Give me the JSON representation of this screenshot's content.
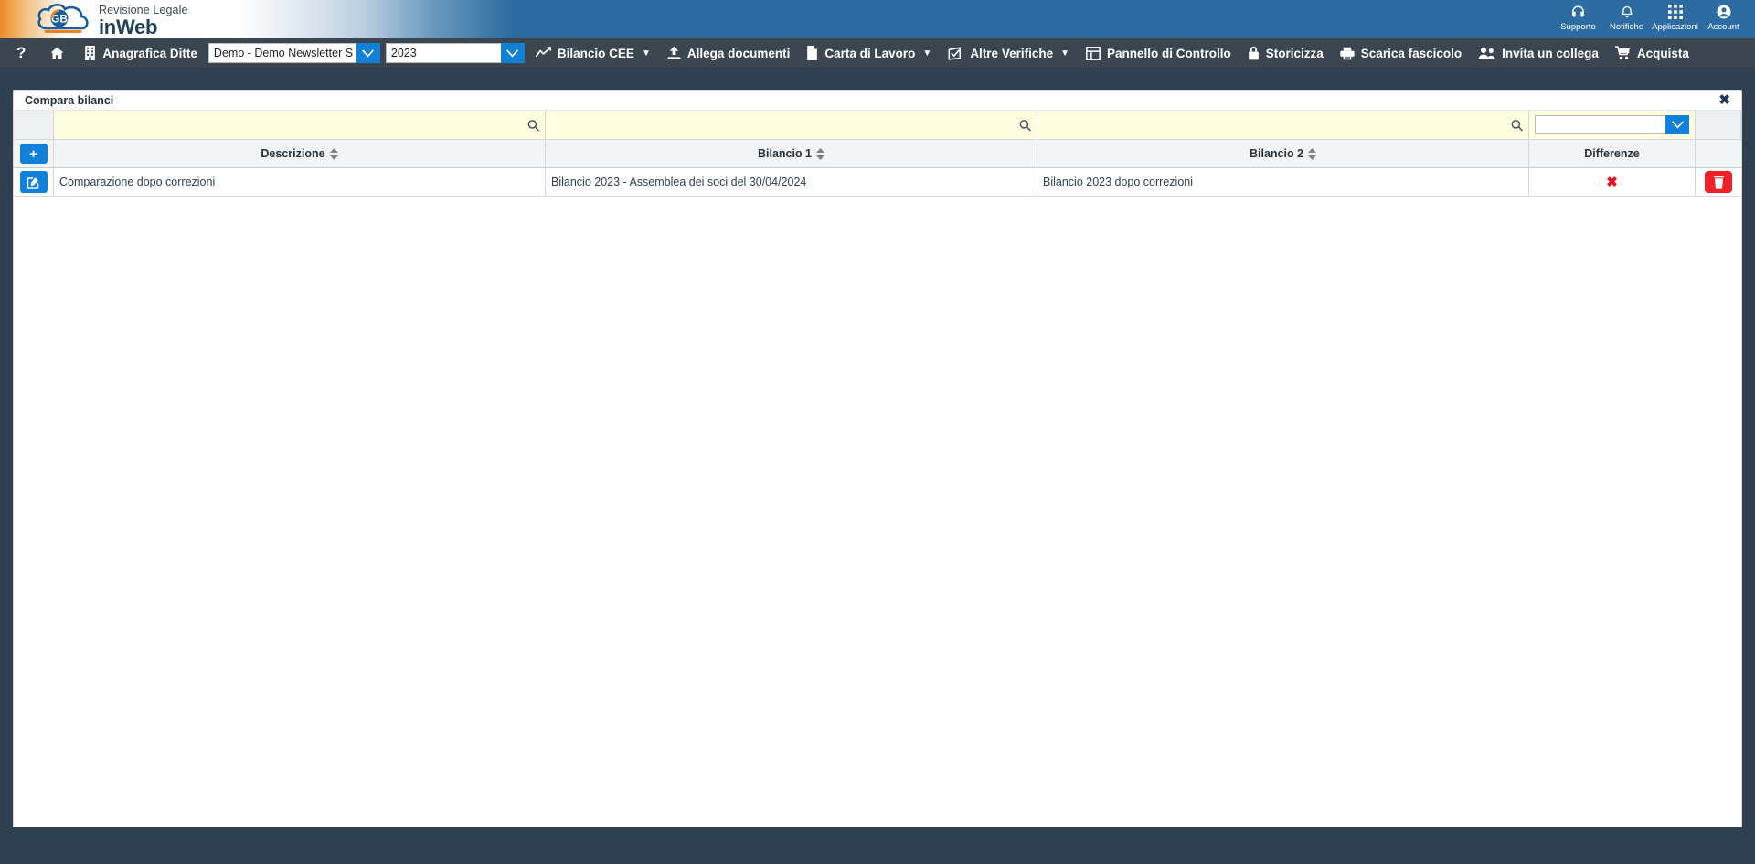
{
  "brand": {
    "line1": "Revisione Legale",
    "line2": "inWeb",
    "logo_text": "GB"
  },
  "header_tools": [
    {
      "label": "Supporto",
      "icon": "headset-icon"
    },
    {
      "label": "Notifiche",
      "icon": "bell-icon"
    },
    {
      "label": "Applicazioni",
      "icon": "grid-apps-icon"
    },
    {
      "label": "Account",
      "icon": "user-circle-icon"
    }
  ],
  "nav": {
    "help_label": "?",
    "home_icon": "home-icon",
    "items": [
      {
        "label": "Anagrafica Ditte",
        "icon": "building-icon",
        "caret": false
      },
      {
        "label": "Bilancio CEE",
        "icon": "chart-line-icon",
        "caret": true
      },
      {
        "label": "Allega documenti",
        "icon": "upload-icon",
        "caret": false
      },
      {
        "label": "Carta di Lavoro",
        "icon": "document-icon",
        "caret": true
      },
      {
        "label": "Altre Verifiche",
        "icon": "clipboard-check-icon",
        "caret": true
      },
      {
        "label": "Pannello di Controllo",
        "icon": "dashboard-grid-icon",
        "caret": false
      },
      {
        "label": "Storicizza",
        "icon": "lock-icon",
        "caret": false
      },
      {
        "label": "Scarica fascicolo",
        "icon": "printer-icon",
        "caret": false
      },
      {
        "label": "Invita un collega",
        "icon": "users-icon",
        "caret": false
      },
      {
        "label": "Acquista",
        "icon": "cart-icon",
        "caret": false
      }
    ],
    "firm_select": {
      "value": "Demo - Demo Newsletter S",
      "placeholder": ""
    },
    "year_select": {
      "value": "2023",
      "placeholder": ""
    }
  },
  "panel": {
    "title": "Compara bilanci",
    "close_label": "✖"
  },
  "grid": {
    "filters": {
      "descrizione": {
        "value": "",
        "placeholder": ""
      },
      "bilancio1": {
        "value": "",
        "placeholder": ""
      },
      "bilancio2": {
        "value": "",
        "placeholder": ""
      },
      "differenze": {
        "value": "",
        "placeholder": ""
      }
    },
    "add_label": "+",
    "columns": [
      {
        "key": "descrizione",
        "label": "Descrizione",
        "sortable": true
      },
      {
        "key": "bilancio1",
        "label": "Bilancio 1",
        "sortable": true
      },
      {
        "key": "bilancio2",
        "label": "Bilancio 2",
        "sortable": true
      },
      {
        "key": "differenze",
        "label": "Differenze",
        "sortable": false
      }
    ],
    "rows": [
      {
        "descrizione": "Comparazione dopo correzioni",
        "bilancio1": "Bilancio 2023 - Assemblea dei soci del 30/04/2024",
        "bilancio2": "Bilancio 2023 dopo correzioni",
        "differenze": "✖",
        "edit_icon": "edit-square-icon",
        "delete_icon": "trash-icon"
      }
    ]
  },
  "colors": {
    "brand_blue": "#2d6ca2",
    "nav_dark": "#3c4650",
    "page_dark": "#2f4050",
    "accent_blue": "#1080d8",
    "danger_red": "#ef2027",
    "filter_yellow": "#ffffe0"
  }
}
